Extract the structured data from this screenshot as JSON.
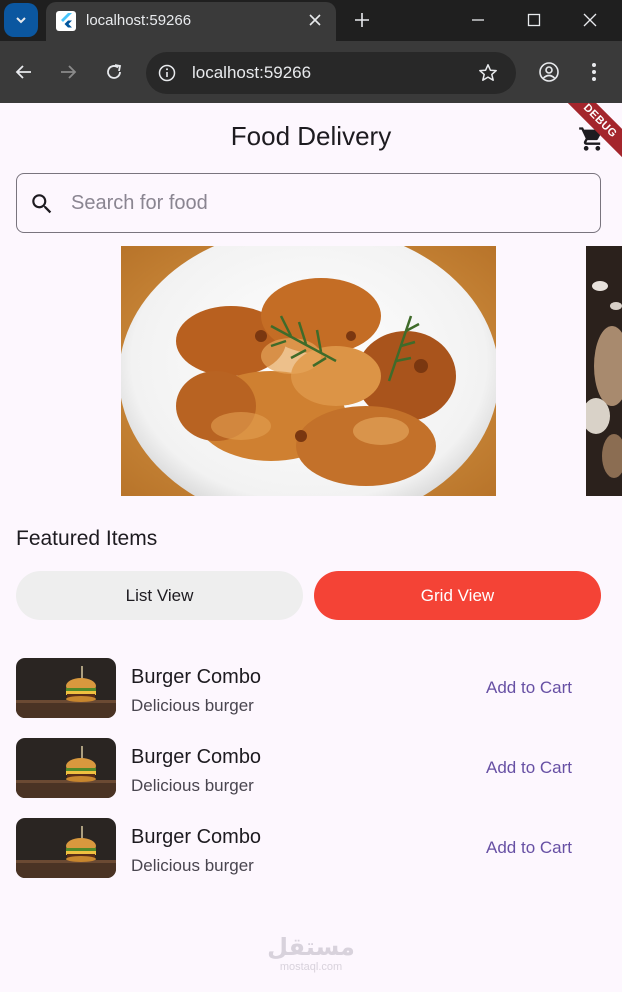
{
  "browser": {
    "tab_title": "localhost:59266",
    "url": "localhost:59266"
  },
  "app": {
    "title": "Food Delivery",
    "debug_label": "DEBUG",
    "search": {
      "placeholder": "Search for food"
    },
    "section_title": "Featured Items",
    "view_toggle": {
      "list_label": "List View",
      "grid_label": "Grid View",
      "selected": "Grid View"
    },
    "items": [
      {
        "title": "Burger Combo",
        "subtitle": "Delicious burger",
        "action": "Add to Cart"
      },
      {
        "title": "Burger Combo",
        "subtitle": "Delicious burger",
        "action": "Add to Cart"
      },
      {
        "title": "Burger Combo",
        "subtitle": "Delicious burger",
        "action": "Add to Cart"
      }
    ]
  },
  "watermark": {
    "main": "مستقل",
    "sub": "mostaql.com"
  },
  "colors": {
    "accent": "#f44336",
    "primary_text": "#6750a4",
    "background": "#fdf7fe",
    "chrome_dark": "#1f1f1f",
    "chrome_toolbar": "#3a3a3a"
  }
}
